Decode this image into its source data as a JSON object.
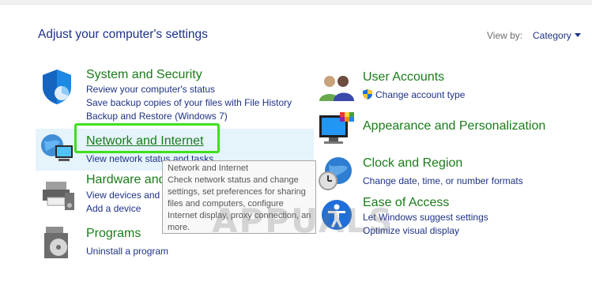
{
  "header": {
    "title": "Adjust your computer's settings",
    "view_by_label": "View by:",
    "view_by_value": "Category"
  },
  "left": {
    "system": {
      "title": "System and Security",
      "links": [
        "Review your computer's status",
        "Save backup copies of your files with File History",
        "Backup and Restore (Windows 7)"
      ]
    },
    "network": {
      "title": "Network and Internet",
      "links": [
        "View network status and tasks"
      ]
    },
    "hardware": {
      "title": "Hardware and Sound",
      "links": [
        "View devices and printers",
        "Add a device"
      ]
    },
    "programs": {
      "title": "Programs",
      "links": [
        "Uninstall a program"
      ]
    }
  },
  "right": {
    "users": {
      "title": "User Accounts",
      "links": [
        "Change account type"
      ]
    },
    "appearance": {
      "title": "Appearance and Personalization"
    },
    "clock": {
      "title": "Clock and Region",
      "links": [
        "Change date, time, or number formats"
      ]
    },
    "ease": {
      "title": "Ease of Access",
      "links": [
        "Let Windows suggest settings",
        "Optimize visual display"
      ]
    }
  },
  "tooltip": {
    "lines": [
      "Network and Internet",
      "Check network status and change",
      "settings, set preferences for sharing",
      "files and computers, configure",
      "Internet display, proxy connection, and",
      "more."
    ]
  },
  "watermark": "APPUALS",
  "colors": {
    "category_green": "#1a7c1a",
    "link_blue": "#1e3287",
    "highlight_green": "#3ee01c"
  }
}
